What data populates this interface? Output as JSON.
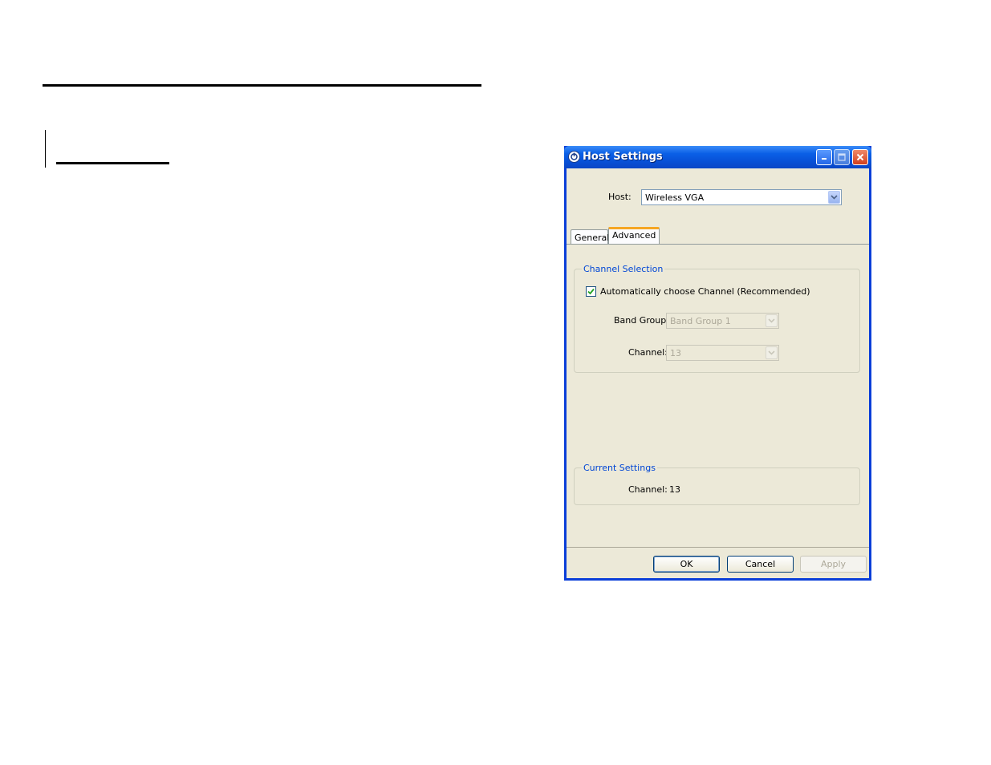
{
  "window": {
    "title": "Host Settings"
  },
  "host": {
    "label": "Host:",
    "value": "Wireless VGA"
  },
  "tabs": [
    {
      "label": "General"
    },
    {
      "label": "Advanced"
    }
  ],
  "channel_selection": {
    "title": "Channel Selection",
    "auto_checkbox": {
      "label": "Automatically choose Channel (Recommended)",
      "checked": true
    },
    "band_group": {
      "label": "Band Group:",
      "value": "Band Group 1"
    },
    "channel": {
      "label": "Channel:",
      "value": "13"
    }
  },
  "current_settings": {
    "title": "Current Settings",
    "channel_label": "Channel:",
    "channel_value": "13"
  },
  "buttons": {
    "ok": "OK",
    "cancel": "Cancel",
    "apply": "Apply"
  },
  "colors": {
    "titlebar": "#0a5fe6",
    "dialog_bg": "#ece9d8",
    "group_title": "#0046d5",
    "active_tab_accent": "#f5a623"
  }
}
